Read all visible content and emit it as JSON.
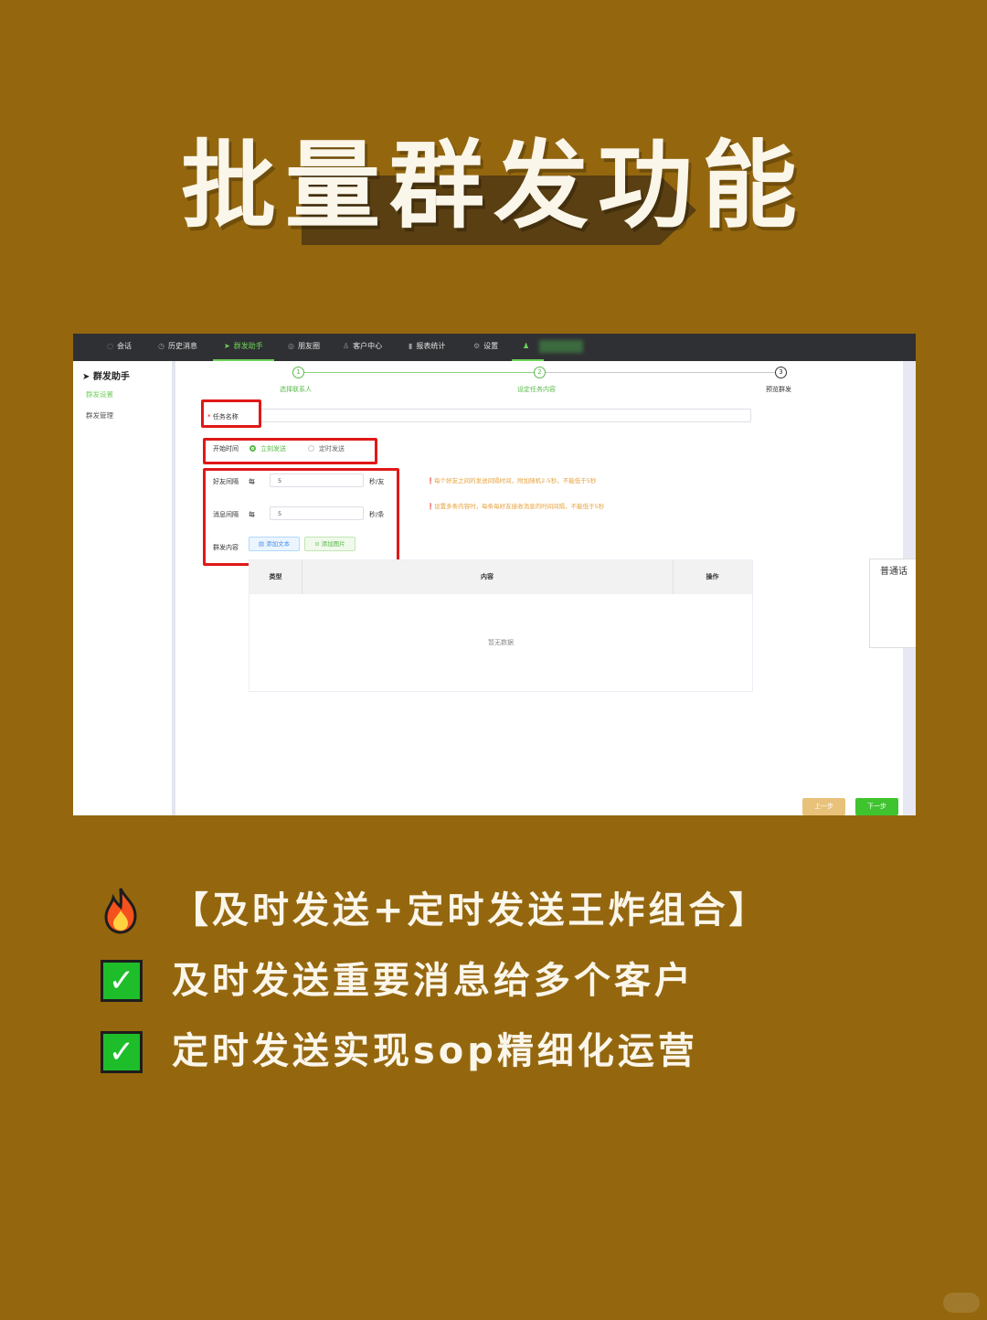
{
  "headline": "批量群发功能",
  "app": {
    "nav": [
      {
        "icon": "chat-icon",
        "label": "会话"
      },
      {
        "icon": "clock-icon",
        "label": "历史消息"
      },
      {
        "icon": "send-icon",
        "label": "群发助手",
        "active": true
      },
      {
        "icon": "moments-icon",
        "label": "朋友圈"
      },
      {
        "icon": "user-icon",
        "label": "客户中心"
      },
      {
        "icon": "bar-chart-icon",
        "label": "报表统计"
      },
      {
        "icon": "gear-icon",
        "label": "设置"
      }
    ],
    "sidebar": {
      "title": "群发助手",
      "items": [
        {
          "label": "群发设置",
          "active": true
        },
        {
          "label": "群发管理",
          "active": false
        }
      ]
    },
    "steps": [
      {
        "num": "1",
        "label": "选择联系人",
        "state": "done"
      },
      {
        "num": "2",
        "label": "设定任务内容",
        "state": "done"
      },
      {
        "num": "3",
        "label": "预览群发",
        "state": "todo"
      }
    ],
    "form": {
      "task_name_label": "任务名称",
      "required_mark": "*",
      "start_time_label": "开始时间",
      "start_options": [
        {
          "label": "立刻发送",
          "selected": true
        },
        {
          "label": "定时发送",
          "selected": false
        }
      ],
      "friend_interval": {
        "label": "好友间隔",
        "prefix": "每",
        "value": "5",
        "unit": "秒/友"
      },
      "message_interval": {
        "label": "消息间隔",
        "prefix": "每",
        "value": "5",
        "unit": "秒/条"
      },
      "content_label": "群发内容",
      "add_text_button": "添加文本",
      "add_image_button": "添加图片",
      "hint_friend": "每个好友之间的发送间隔时间，附加随机2-5秒，不能低于5秒",
      "hint_message": "设置多条内容时，每条每好友接收消息的时间间隔，不能低于5秒"
    },
    "table": {
      "columns": [
        "类型",
        "内容",
        "操作"
      ],
      "empty_text": "暂无数据"
    },
    "popup_text": "普通话",
    "prev_button": "上一步",
    "next_button": "下一步"
  },
  "bullets": [
    {
      "icon": "fire-icon",
      "text": "【及时发送+定时发送王炸组合】"
    },
    {
      "icon": "check-icon",
      "text": "及时发送重要消息给多个客户"
    },
    {
      "icon": "check-icon",
      "text": "定时发送实现sop精细化运营"
    }
  ],
  "colors": {
    "background": "#94670f",
    "accent_green": "#6fd15a",
    "highlight_red": "#e01818",
    "check_green": "#1ebd2a"
  }
}
